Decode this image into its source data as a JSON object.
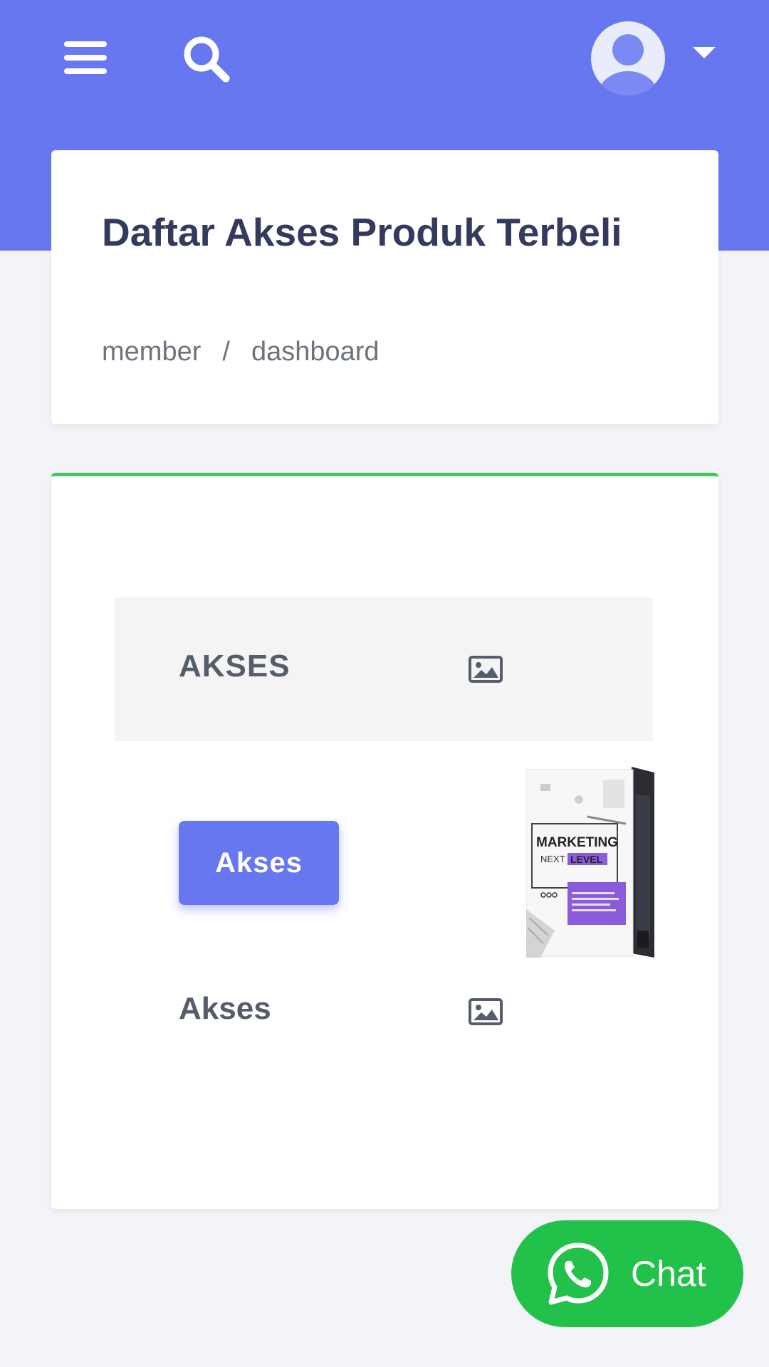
{
  "header": {
    "menu_icon": "hamburger-menu-icon",
    "search_icon": "search-icon",
    "avatar_icon": "user-avatar-icon",
    "caret_icon": "caret-down-icon",
    "bg_color": "#6777ef"
  },
  "page": {
    "title": "Daftar Akses Produk Terbeli",
    "breadcrumb": [
      "member",
      "/",
      "dashboard"
    ]
  },
  "table": {
    "accent_color": "#47c363",
    "header": {
      "col1": "AKSES",
      "col2_icon": "image-icon"
    },
    "rows": [
      {
        "button_label": "Akses",
        "product_image_lines": [
          "MARKETING",
          "NEXT",
          "LEVEL"
        ]
      },
      {
        "label": "Akses",
        "image_icon": "image-icon"
      }
    ]
  },
  "chat": {
    "label": "Chat",
    "icon": "whatsapp-icon",
    "color": "#21c14a"
  }
}
